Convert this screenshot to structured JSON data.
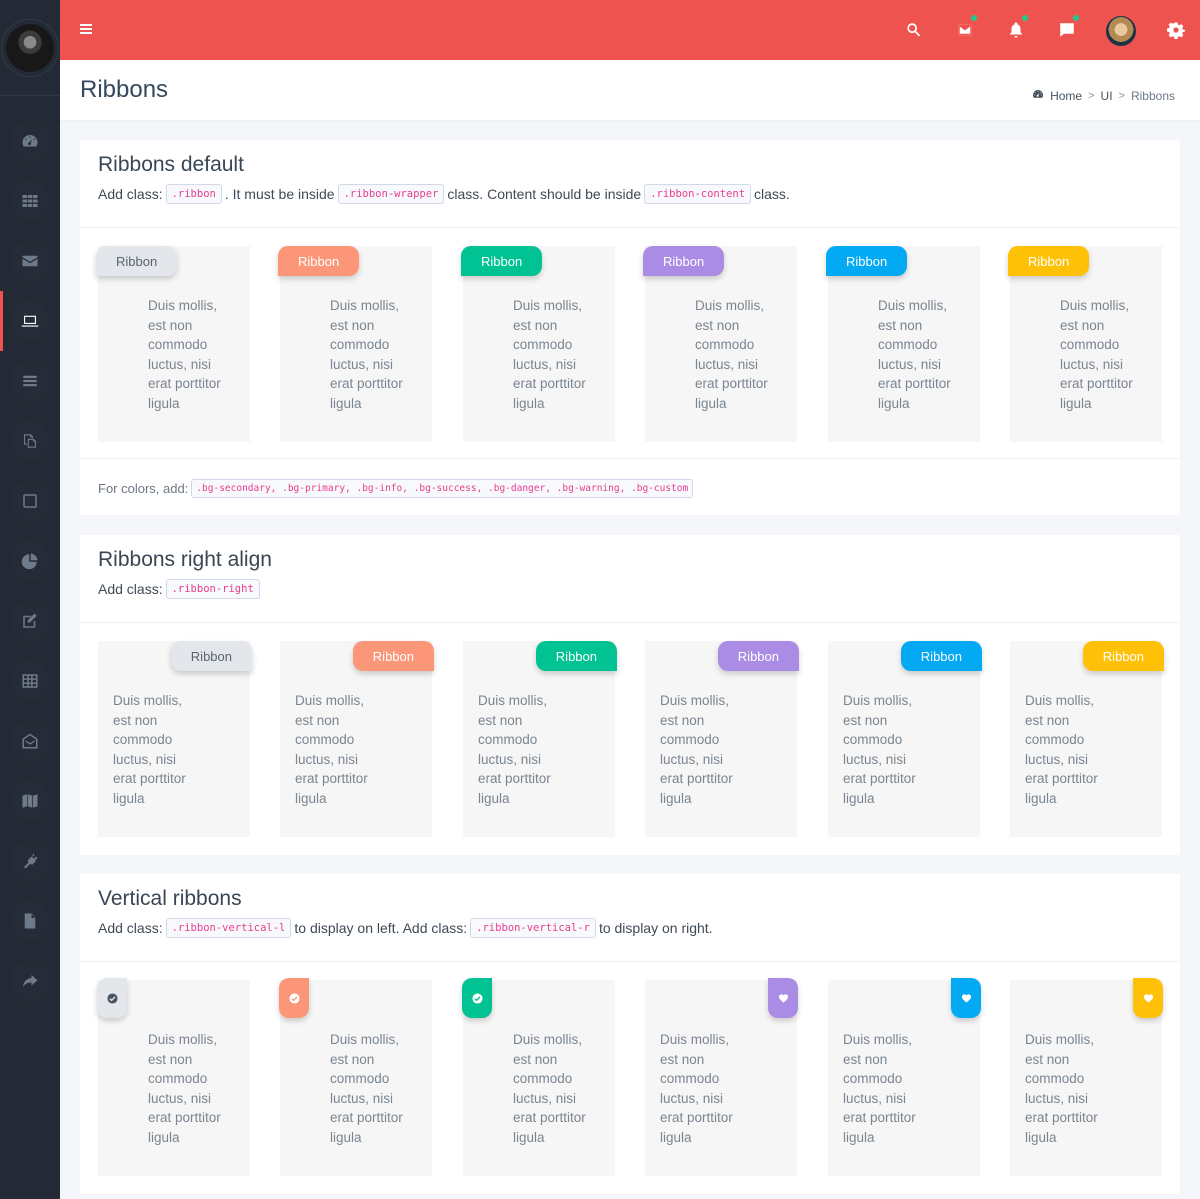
{
  "header": {
    "menu_icon": "hamburger-icon",
    "icons": [
      "search-icon",
      "mail-icon",
      "bell-icon",
      "chat-icon",
      "user-avatar",
      "gear-icon"
    ],
    "notification_dot_color": "#1fc98e",
    "brand_color": "#ef5350"
  },
  "sidebar": {
    "items": [
      {
        "icon": "dashboard-icon"
      },
      {
        "icon": "apps-grid-icon"
      },
      {
        "icon": "envelope-icon"
      },
      {
        "icon": "laptop-icon",
        "active": true
      },
      {
        "icon": "list-icon"
      },
      {
        "icon": "copy-icon"
      },
      {
        "icon": "square-icon"
      },
      {
        "icon": "pie-chart-icon"
      },
      {
        "icon": "edit-icon"
      },
      {
        "icon": "table-icon"
      },
      {
        "icon": "envelope-open-icon"
      },
      {
        "icon": "map-icon"
      },
      {
        "icon": "plug-icon"
      },
      {
        "icon": "file-icon"
      },
      {
        "icon": "share-icon"
      }
    ]
  },
  "page": {
    "title": "Ribbons",
    "breadcrumb": {
      "home": "Home",
      "section": "UI",
      "current": "Ribbons",
      "sep": ">"
    }
  },
  "colors": {
    "secondary": "#e3e7eb",
    "primary": "#fb9678",
    "success": "#00c292",
    "purple": "#ab8ce4",
    "info": "#03a9f3",
    "warning": "#fec107"
  },
  "sections": {
    "default": {
      "title": "Ribbons default",
      "desc_prefix": "Add class:",
      "code1": ".ribbon",
      "text2": ". It must be inside",
      "code2": ".ribbon-wrapper",
      "text3": "class. Content should be inside",
      "code3": ".ribbon-content",
      "text4": "class.",
      "colors_label": "For colors, add:",
      "colors_code": ".bg-secondary, .bg-primary, .bg-info, .bg-success, .bg-danger, .bg-warning, .bg-custom"
    },
    "right": {
      "title": "Ribbons right align",
      "desc_prefix": "Add class:",
      "code1": ".ribbon-right"
    },
    "vertical": {
      "title": "Vertical ribbons",
      "desc_prefix": "Add class:",
      "code1": ".ribbon-vertical-l",
      "text2": "to display on left. Add class:",
      "code2": ".ribbon-vertical-r",
      "text3": "to display on right."
    }
  },
  "ribbon_label": "Ribbon",
  "content_lines": [
    "Duis mollis,",
    "est non",
    "commodo",
    "luctus, nisi",
    "erat porttitor",
    "ligula"
  ],
  "vertical_icons": [
    "check-circle-icon",
    "check-circle-icon",
    "check-circle-icon",
    "heart-icon",
    "heart-icon",
    "heart-icon"
  ]
}
